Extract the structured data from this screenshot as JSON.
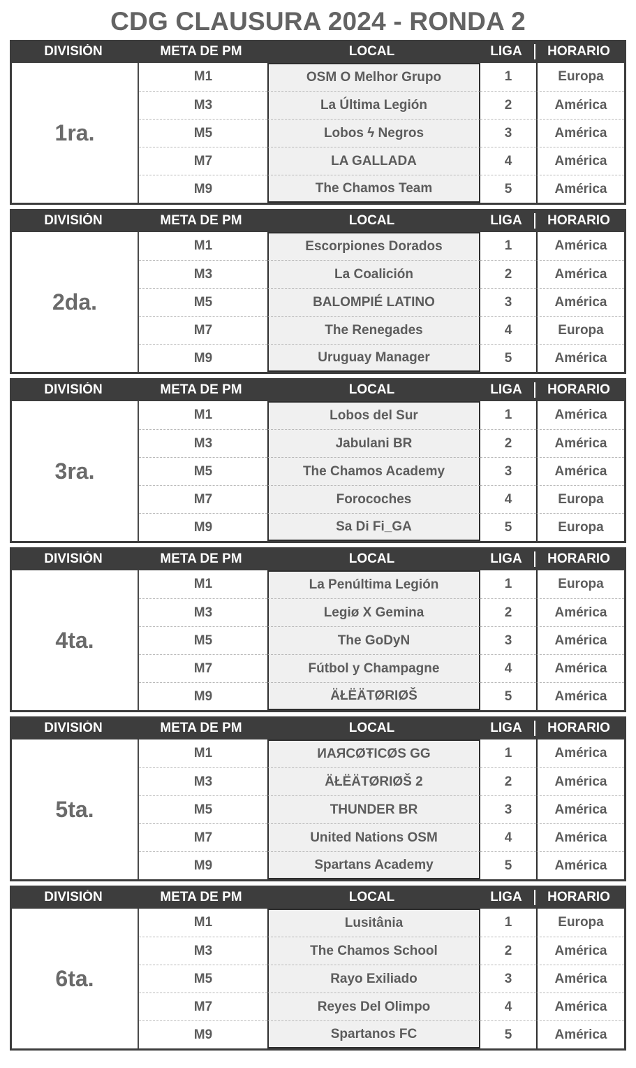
{
  "title": "CDG CLAUSURA 2024 - RONDA 2",
  "colors": {
    "header_bg": "#3d3d3d",
    "header_text": "#ffffff",
    "title_text": "#636363",
    "body_text": "#5c5c5c",
    "local_column_bg": "#f0f0f0",
    "border": "#2e2e2e",
    "row_divider": "#b9b9b9"
  },
  "columns": {
    "division": "DIVISIÓN",
    "meta": "META DE PM",
    "local": "LOCAL",
    "liga": "LIGA",
    "horario": "HORARIO"
  },
  "divisions": [
    {
      "name": "1ra.",
      "rows": [
        {
          "meta": "M1",
          "local": "OSM O Melhor Grupo",
          "liga": "1",
          "horario": "Europa"
        },
        {
          "meta": "M3",
          "local": "La Última Legión",
          "liga": "2",
          "horario": "América"
        },
        {
          "meta": "M5",
          "local": "Lobos ϟ Negros",
          "liga": "3",
          "horario": "América"
        },
        {
          "meta": "M7",
          "local": "LA GALLADA",
          "liga": "4",
          "horario": "América"
        },
        {
          "meta": "M9",
          "local": "The Chamos Team",
          "liga": "5",
          "horario": "América"
        }
      ]
    },
    {
      "name": "2da.",
      "rows": [
        {
          "meta": "M1",
          "local": "Escorpiones Dorados",
          "liga": "1",
          "horario": "América"
        },
        {
          "meta": "M3",
          "local": "La Coalición",
          "liga": "2",
          "horario": "América"
        },
        {
          "meta": "M5",
          "local": "BALOMPIÉ LATINO",
          "liga": "3",
          "horario": "América"
        },
        {
          "meta": "M7",
          "local": "The Renegades",
          "liga": "4",
          "horario": "Europa"
        },
        {
          "meta": "M9",
          "local": "Uruguay Manager",
          "liga": "5",
          "horario": "América"
        }
      ]
    },
    {
      "name": "3ra.",
      "rows": [
        {
          "meta": "M1",
          "local": "Lobos del Sur",
          "liga": "1",
          "horario": "América"
        },
        {
          "meta": "M3",
          "local": "Jabulani BR",
          "liga": "2",
          "horario": "América"
        },
        {
          "meta": "M5",
          "local": "The Chamos Academy",
          "liga": "3",
          "horario": "América"
        },
        {
          "meta": "M7",
          "local": "Forocoches",
          "liga": "4",
          "horario": "Europa"
        },
        {
          "meta": "M9",
          "local": "Sa Di Fi_GA",
          "liga": "5",
          "horario": "Europa"
        }
      ]
    },
    {
      "name": "4ta.",
      "rows": [
        {
          "meta": "M1",
          "local": "La Penúltima Legión",
          "liga": "1",
          "horario": "Europa"
        },
        {
          "meta": "M3",
          "local": "Legiø X Gemina",
          "liga": "2",
          "horario": "América"
        },
        {
          "meta": "M5",
          "local": "The GoDyN",
          "liga": "3",
          "horario": "América"
        },
        {
          "meta": "M7",
          "local": "Fútbol y Champagne",
          "liga": "4",
          "horario": "América"
        },
        {
          "meta": "M9",
          "local": "ÄŁËÄTØRIØŠ",
          "liga": "5",
          "horario": "América"
        }
      ]
    },
    {
      "name": "5ta.",
      "rows": [
        {
          "meta": "M1",
          "local": "ИАЯCØŦICØS GG",
          "liga": "1",
          "horario": "América"
        },
        {
          "meta": "M3",
          "local": "ÄŁËÄTØRIØŠ 2",
          "liga": "2",
          "horario": "América"
        },
        {
          "meta": "M5",
          "local": "THUNDER BR",
          "liga": "3",
          "horario": "América"
        },
        {
          "meta": "M7",
          "local": "United Nations OSM",
          "liga": "4",
          "horario": "América"
        },
        {
          "meta": "M9",
          "local": "Spartans Academy",
          "liga": "5",
          "horario": "América"
        }
      ]
    },
    {
      "name": "6ta.",
      "rows": [
        {
          "meta": "M1",
          "local": "Lusitânia",
          "liga": "1",
          "horario": "Europa"
        },
        {
          "meta": "M3",
          "local": "The Chamos School",
          "liga": "2",
          "horario": "América"
        },
        {
          "meta": "M5",
          "local": "Rayo Exiliado",
          "liga": "3",
          "horario": "América"
        },
        {
          "meta": "M7",
          "local": "Reyes Del Olimpo",
          "liga": "4",
          "horario": "América"
        },
        {
          "meta": "M9",
          "local": "Spartanos FC",
          "liga": "5",
          "horario": "América"
        }
      ]
    }
  ]
}
